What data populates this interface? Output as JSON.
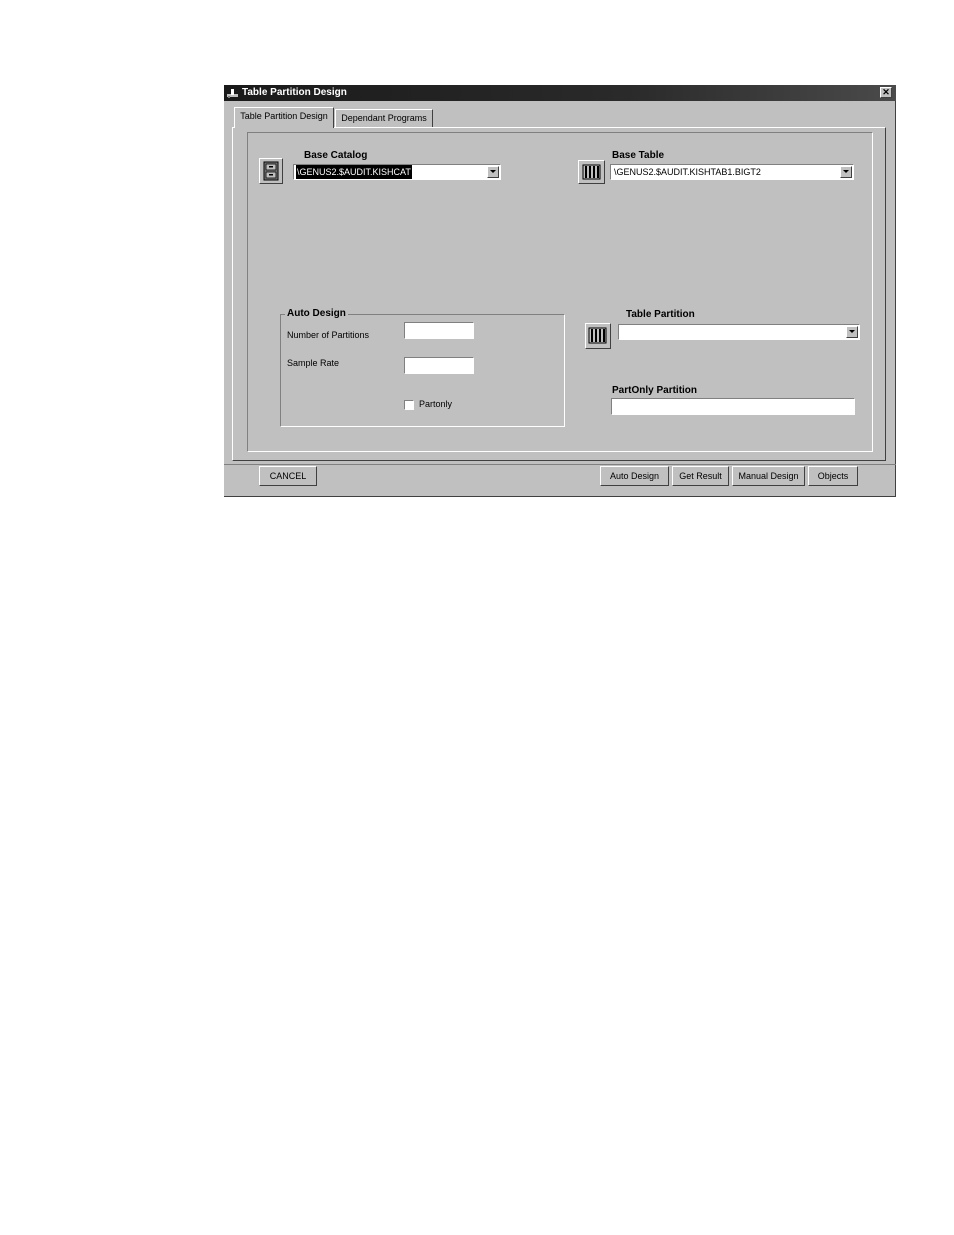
{
  "window": {
    "title": "Table Partition Design",
    "close_glyph": "✕"
  },
  "tabs": [
    {
      "label": "Table Partition Design",
      "mnemonic_index": 6,
      "active": true
    },
    {
      "label": "Dependant Programs",
      "mnemonic_index": 10,
      "active": false
    }
  ],
  "base_catalog": {
    "label": "Base Catalog",
    "value": "\\GENUS2.$AUDIT.KISHCAT",
    "icon": "cabinet-icon"
  },
  "base_table": {
    "label": "Base Table",
    "value": "\\GENUS2.$AUDIT.KISHTAB1.BIGT2",
    "icon": "table-columns-icon"
  },
  "auto_design": {
    "group_label": "Auto Design",
    "num_partitions_label": "Number of Partitions",
    "num_partitions_value": "",
    "sample_rate_label": "Sample Rate",
    "sample_rate_value": "",
    "partonly_label": "Partonly",
    "partonly_checked": false
  },
  "table_partition": {
    "label": "Table Partition",
    "value": "",
    "icon": "table-columns-icon"
  },
  "partonly_partition": {
    "label": "PartOnly Partition",
    "value": ""
  },
  "buttons": {
    "cancel": "CANCEL",
    "auto_design": "Auto Design",
    "get_result": "Get Result",
    "manual_design": "Manual Design",
    "objects": "Objects"
  }
}
